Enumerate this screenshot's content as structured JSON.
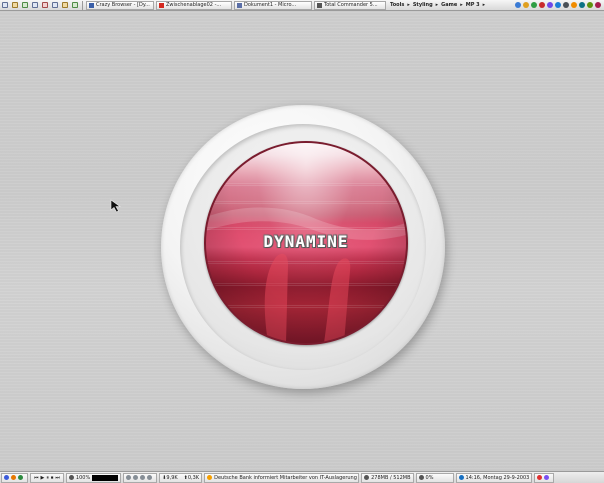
{
  "topbar": {
    "tasks": [
      {
        "label": "Crazy Browser - [Dy..."
      },
      {
        "label": "Zwischenablage02 -..."
      },
      {
        "label": "Dokument1 - Micro..."
      },
      {
        "label": "Total Commander 5..."
      }
    ],
    "menus": [
      {
        "label": "Tools",
        "arrow": "▸"
      },
      {
        "label": "Styling",
        "arrow": "▸"
      },
      {
        "label": "Game",
        "arrow": "▸"
      },
      {
        "label": "MP 3",
        "arrow": "▸"
      }
    ]
  },
  "center": {
    "logo_text": "DYNAMINE"
  },
  "bottombar": {
    "zoom": "100%",
    "net_down": "9,9K",
    "net_up": "0,3K",
    "news_ticker": "Deutsche Bank informiert Mitarbeiter von IT-Auslagerung",
    "memory": "278MB / 512MB",
    "cpu": "0%",
    "datetime": "14:16, Montag 29-9-2003"
  },
  "colors": {
    "accent_red": "#d4281f",
    "lens_rim": "#7a1c2e",
    "lens_mid": "#e04e6f"
  }
}
